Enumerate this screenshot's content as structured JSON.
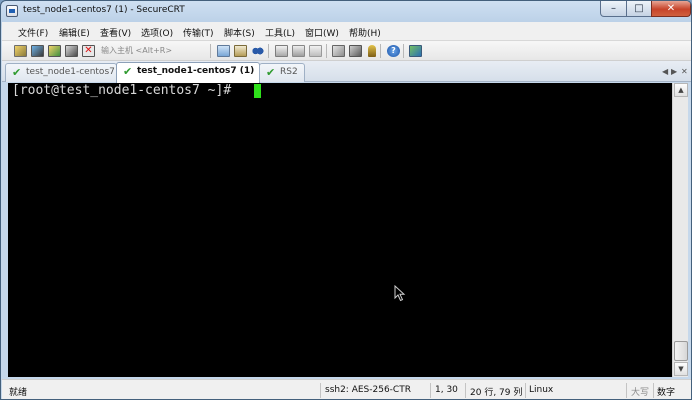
{
  "window": {
    "title": "test_node1-centos7 (1) - SecureCRT"
  },
  "window_controls": {
    "minimize": "–",
    "maximize": "□",
    "close": "✕"
  },
  "menu": [
    "文件(F)",
    "编辑(E)",
    "查看(V)",
    "选项(O)",
    "传输(T)",
    "脚本(S)",
    "工具(L)",
    "窗口(W)",
    "帮助(H)"
  ],
  "toolbar": {
    "quick_connect_placeholder": "输入主机 <Alt+R>",
    "icons": [
      "connect-icon",
      "quick-connect-icon",
      "connect-in-tab-icon",
      "reconnect-icon",
      "disconnect-icon",
      "copy-icon",
      "paste-icon",
      "find-icon",
      "print-icon",
      "print-setup-icon",
      "options-icon",
      "session-options-icon",
      "global-options-icon",
      "keymap-icon",
      "help-icon",
      "sftp-icon"
    ]
  },
  "tabs": [
    {
      "label": "test_node1-centos7",
      "active": false
    },
    {
      "label": "test_node1-centos7 (1)",
      "active": true
    },
    {
      "label": "RS2",
      "active": false
    }
  ],
  "tab_nav": {
    "prev": "◀",
    "next": "▶",
    "close": "✕"
  },
  "terminal": {
    "prompt": "[root@test_node1-centos7 ~]# ",
    "background": "#000000",
    "foreground": "#d8d8d8",
    "cursor_color": "#2fe01b"
  },
  "status": {
    "ready": "就绪",
    "cipher": "ssh2: AES-256-CTR",
    "position": "1,  30",
    "size": "20 行, 79 列",
    "os": "Linux",
    "caps": "大写",
    "num": "数字"
  }
}
